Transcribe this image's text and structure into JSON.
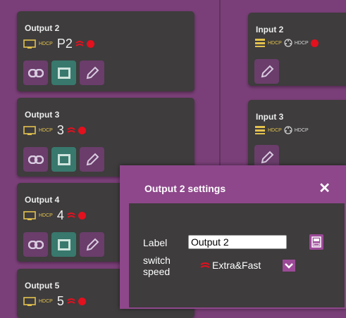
{
  "outputs": [
    {
      "title": "Output 2",
      "hdcp": "HDCP",
      "number": "P2"
    },
    {
      "title": "Output 3",
      "hdcp": "HDCP",
      "number": "3"
    },
    {
      "title": "Output 4",
      "hdcp": "HDCP",
      "number": "4"
    },
    {
      "title": "Output 5",
      "hdcp": "HDCP",
      "number": "5"
    }
  ],
  "inputs": [
    {
      "title": "Input 2",
      "hdcp": "HDCP",
      "hdcp2": "HDCP"
    },
    {
      "title": "Input 3",
      "hdcp": "HDCP",
      "hdcp2": "HDCP"
    }
  ],
  "dialog": {
    "title": "Output 2 settings",
    "close": "✕",
    "label_label": "Label",
    "label_value": "Output 2",
    "speed_label_1": "switch",
    "speed_label_2": "speed",
    "speed_value": "Extra&Fast"
  },
  "colors": {
    "background": "#7a3f78",
    "card": "#3e3c3d",
    "button": "#6a3d6b",
    "button_active": "#38786d",
    "hdcp": "#e3c24d",
    "status_red": "#e3101e",
    "dialog_header": "#8e478b"
  }
}
